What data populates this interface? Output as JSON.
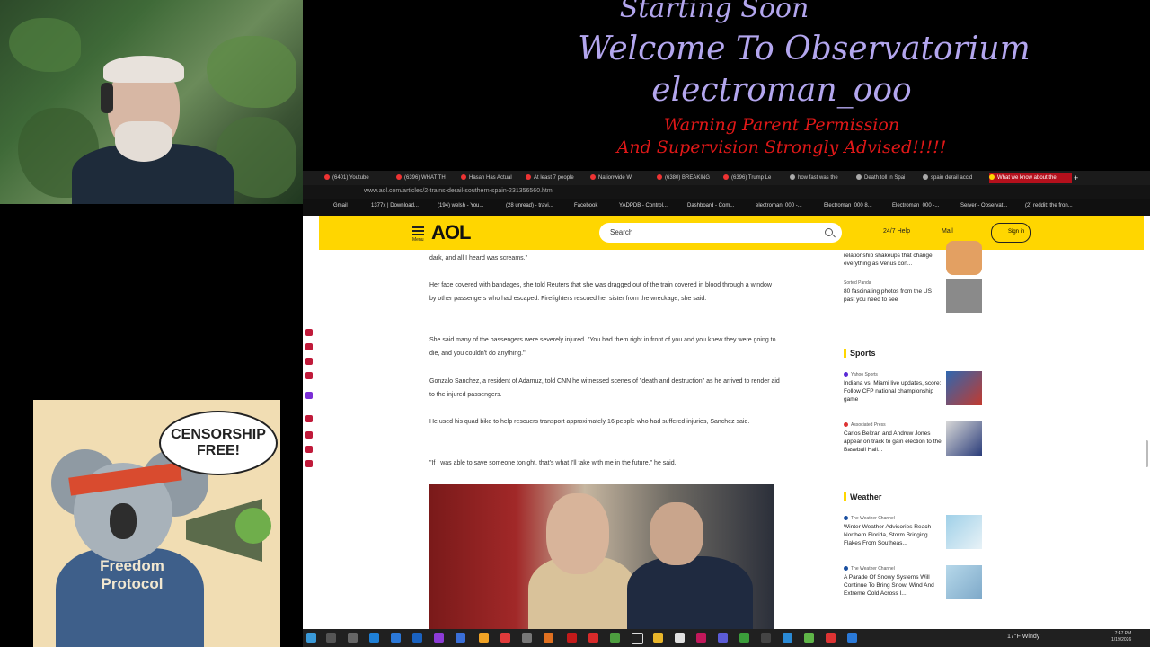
{
  "overlay": {
    "line1": "Starting Soon",
    "line2": "Welcome To Observatorium",
    "line3": "electroman_ooo",
    "warning1": "Warning Parent Permission",
    "warning2": "And Supervision Strongly Advised!!!!!"
  },
  "koala": {
    "bubble": "CENSORSHIP FREE!",
    "hoodie": "Freedom Protocol"
  },
  "browser": {
    "tabs": [
      {
        "label": "(6401) Youtube"
      },
      {
        "label": "(6396) WHAT TH"
      },
      {
        "label": "Hasan Has Actual"
      },
      {
        "label": "At least 7 people"
      },
      {
        "label": "Nationwide W"
      },
      {
        "label": "(6380) BREAKING"
      },
      {
        "label": "(6396) Trump Le"
      },
      {
        "label": "how fast was the"
      },
      {
        "label": "Death toll in Spai"
      },
      {
        "label": "spain derail accid"
      },
      {
        "label": "What we know about the"
      }
    ],
    "url": "www.aol.com/articles/2-trains-derail-southern-spain-231356560.html",
    "bookmarks": [
      "Gmail",
      "1377x | Download...",
      "(194) welsh - You...",
      "(28 unread) - travi...",
      "Facebook",
      "YADPDB - Control...",
      "Dashboard - Com...",
      "electroman_000 -...",
      "Electroman_000 8...",
      "Electroman_000 -...",
      "Server - Observat...",
      "(2) reddit: the fron..."
    ]
  },
  "aol": {
    "menu_label": "Menu",
    "logo": "AOL",
    "search_placeholder": "Search",
    "help": "24/7 Help",
    "mail": "Mail",
    "signin": "Sign in"
  },
  "article": {
    "paragraphs": [
      "dark, and all I heard was screams.\"",
      "Her face covered with bandages, she told Reuters that she was dragged out of the train covered in blood through a window by other passengers who had escaped. Firefighters rescued her sister from the wreckage, she said.",
      "She said many of the passengers were severely injured. \"You had them right in front of you and you knew they were going to die, and you couldn't do anything.\"",
      "Gonzalo Sanchez, a resident of Adamuz, told CNN he witnessed scenes of \"death and destruction\" as he arrived to render aid to the injured passengers.",
      "He used his quad bike to help rescuers transport approximately 16 people who had suffered injuries, Sanchez said.",
      "\"If I was able to save someone tonight, that's what I'll take with me in the future,\" he said."
    ]
  },
  "rail": {
    "top_partial": "relationship shakeups that change everything as Venus con...",
    "items_top": [
      {
        "source": "Sorted Panda",
        "headline": "80 fascinating photos from the US past you need to see"
      }
    ],
    "sports_title": "Sports",
    "sports": [
      {
        "source": "Yahoo Sports",
        "headline": "Indiana vs. Miami live updates, score: Follow CFP national championship game"
      },
      {
        "source": "Associated Press",
        "headline": "Carlos Beltran and Andruw Jones appear on track to gain election to the Baseball Hall..."
      }
    ],
    "weather_title": "Weather",
    "weather": [
      {
        "source": "The Weather Channel",
        "headline": "Winter Weather Advisories Reach Northern Florida, Storm Bringing Flakes From Southeas..."
      },
      {
        "source": "The Weather Channel",
        "headline": "A Parade Of Snowy Systems Will Continue To Bring Snow, Wind And Extreme Cold Across I..."
      }
    ]
  },
  "taskbar": {
    "weather": "17°F Windy",
    "time": "7:47 PM",
    "date": "1/19/2026"
  }
}
